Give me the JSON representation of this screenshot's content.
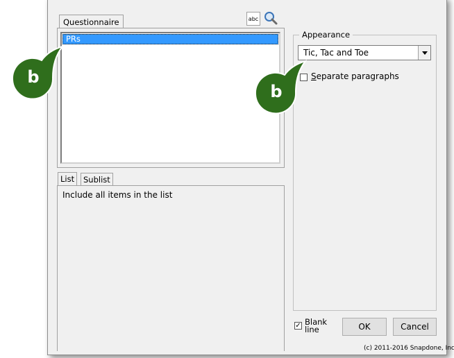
{
  "left_panel": {
    "tab_label": "Questionnaire",
    "list_items": [
      "PRs"
    ],
    "abc_button_label": "abc"
  },
  "lower_panel": {
    "tabs": [
      "List",
      "Sublist"
    ],
    "description": "Include all items in the list"
  },
  "appearance": {
    "legend": "Appearance",
    "selected_style": "Tic, Tac and Toe",
    "separate_paragraphs_label": "Separate paragraphs",
    "separate_paragraphs_checked": false
  },
  "footer": {
    "blank_line_label": "Blank line",
    "blank_line_checked": true,
    "ok_label": "OK",
    "cancel_label": "Cancel",
    "copyright": "(c) 2011-2016 Snapdone, Inc."
  },
  "callouts": [
    "b",
    "b"
  ],
  "colors": {
    "selection": "#3399ff",
    "callout": "#2f6e1c"
  }
}
